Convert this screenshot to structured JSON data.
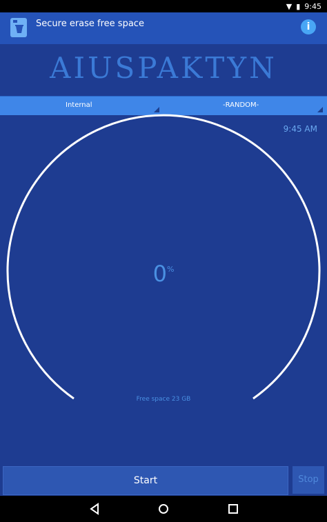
{
  "status_bar": {
    "time": "9:45"
  },
  "app_bar": {
    "title": "Secure erase free space",
    "info_icon": "info-icon"
  },
  "logo_text": "AIUSPAKTYN",
  "selectors": {
    "storage": {
      "value": "Internal"
    },
    "mode": {
      "value": "-RANDOM-"
    }
  },
  "time_label": "9:45 AM",
  "gauge": {
    "progress_value": "0",
    "progress_unit": "%",
    "progress_fraction": 0,
    "free_space_label": "Free space 23 GB"
  },
  "buttons": {
    "start_label": "Start",
    "stop_label": "Stop"
  },
  "colors": {
    "background": "#1e3c91",
    "appbar": "#2553b8",
    "accent": "#4a90e2",
    "selector_bar": "#3f86e8"
  }
}
